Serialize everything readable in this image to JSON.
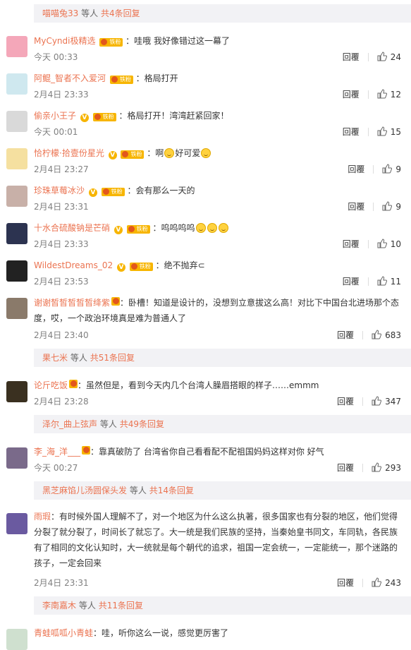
{
  "top_reply": {
    "name": "喵喵兔33",
    "suffix": "等人",
    "more": "共4条回复"
  },
  "comments": [
    {
      "user": "MyCyndi极精选",
      "badges": {
        "fan": "铁粉"
      },
      "text": "：哇哦 我好像错过这一幕了",
      "time": "今天 00:33",
      "reply": "回覆",
      "likes": "24"
    },
    {
      "user": "阿鲲_智者不入爱河",
      "badges": {
        "fan": "铁粉"
      },
      "text": "：格局打开",
      "time": "2月4日 23:33",
      "reply": "回覆",
      "likes": "12"
    },
    {
      "user": "偷亲小王子",
      "badges": {
        "v": "V",
        "fan": "铁粉"
      },
      "text": "：格局打开！湾湾赶紧回家！",
      "time": "今天 00:01",
      "reply": "回覆",
      "likes": "15"
    },
    {
      "user": "恰柠檬·拾壹份星光",
      "badges": {
        "v": "V",
        "fan": "铁粉"
      },
      "text": "：啊",
      "text2": "好可爱",
      "time": "2月4日 23:27",
      "reply": "回覆",
      "likes": "9"
    },
    {
      "user": "珍珠草莓冰沙",
      "badges": {
        "v": "V",
        "fan": "铁粉"
      },
      "text": "：会有那么一天的",
      "time": "2月4日 23:31",
      "reply": "回覆",
      "likes": "9"
    },
    {
      "user": "十水合硫酸钠是芒硝",
      "badges": {
        "v": "V",
        "fan": "铁粉"
      },
      "text": "：呜呜呜呜",
      "time": "2月4日 23:33",
      "reply": "回覆",
      "likes": "10"
    },
    {
      "user": "WildestDreams_02",
      "badges": {
        "v": "V",
        "fan": "铁粉"
      },
      "text": "：绝不抛弃⊂",
      "time": "2月4日 23:53",
      "reply": "回覆",
      "likes": "11"
    },
    {
      "user": "谢谢皙皙皙皙皙绛紫",
      "badges": {},
      "text": "：卧槽！知道是设计的，没想到立意拔这么高！对比下中国台北进场那个态度，哎，一个政治环境真是难为普通人了",
      "time": "2月4日 23:40",
      "reply": "回覆",
      "likes": "683"
    },
    {
      "user": "论斤吃饭",
      "badges": {},
      "text": "：虽然但是，看到今天内几个台湾人臊眉搭眼的样子……emmm",
      "time": "2月4日 23:28",
      "reply": "回覆",
      "likes": "347"
    },
    {
      "user": "李_海_洋___",
      "badges": {},
      "text": "：靠真破防了 台湾省你自己看看配不配祖国妈妈这样对你 好气",
      "time": "今天 00:27",
      "reply": "回覆",
      "likes": "293"
    },
    {
      "user": "雨瑕",
      "badges": {},
      "text": "：有时候外国人理解不了，对一个地区为什么这么执著，很多国家也有分裂的地区，他们觉得分裂了就分裂了，时间长了就忘了。大一统是我们民族的坚持，当秦始皇书同文，车同轨，各民族有了相同的文化认知时，大一统就是每个朝代的追求，祖国一定会统一，一定能统一，那个迷路的孩子，一定会回来",
      "time": "2月4日 23:31",
      "reply": "回覆",
      "likes": "243"
    },
    {
      "user": "青蛙呱呱小青蛙",
      "badges": {},
      "text": "：哇，听你这么一说，感觉更厉害了"
    }
  ],
  "reply_boxes": [
    {
      "name": "果七米",
      "suffix": "等人",
      "more": "共51条回复"
    },
    {
      "name": "泽尔_曲上弦声",
      "suffix": "等人",
      "more": "共49条回复"
    },
    {
      "name": "黑芝麻馅儿汤圆保头发",
      "suffix": "等人",
      "more": "共14条回复"
    },
    {
      "name": "李南嘉木",
      "suffix": "等人",
      "more": "共11条回复"
    }
  ],
  "colors": {
    "accent": "#eb7350",
    "badge": "#f7b500"
  }
}
